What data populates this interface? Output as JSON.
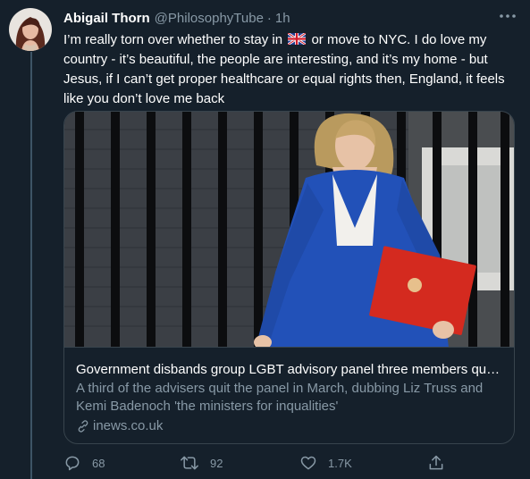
{
  "tweet": {
    "display_name": "Abigail Thorn",
    "handle": "@PhilosophyTube",
    "separator": "·",
    "time": "1h",
    "text_part1": "I’m really torn over whether to stay in",
    "flag_icon": "uk-flag-icon",
    "text_part2": "or move to NYC. I do love my country - it’s beautiful, the people are interesting, and it’s my home - but Jesus, if I can’t get proper healthcare or equal rights then, England, it feels like you don’t love me back"
  },
  "card": {
    "title": "Government disbands group LGBT advisory panel three members quit l...",
    "description": "A third of the advisers quit the panel in March, dubbing Liz Truss and Kemi Badenoch 'the ministers for inqualities'",
    "domain": "inews.co.uk"
  },
  "actions": {
    "replies": "68",
    "retweets": "92",
    "likes": "1.7K"
  },
  "colors": {
    "background": "#15202b",
    "secondary_text": "#8899a6",
    "border": "#38444d",
    "blazer": "#2251b8"
  }
}
